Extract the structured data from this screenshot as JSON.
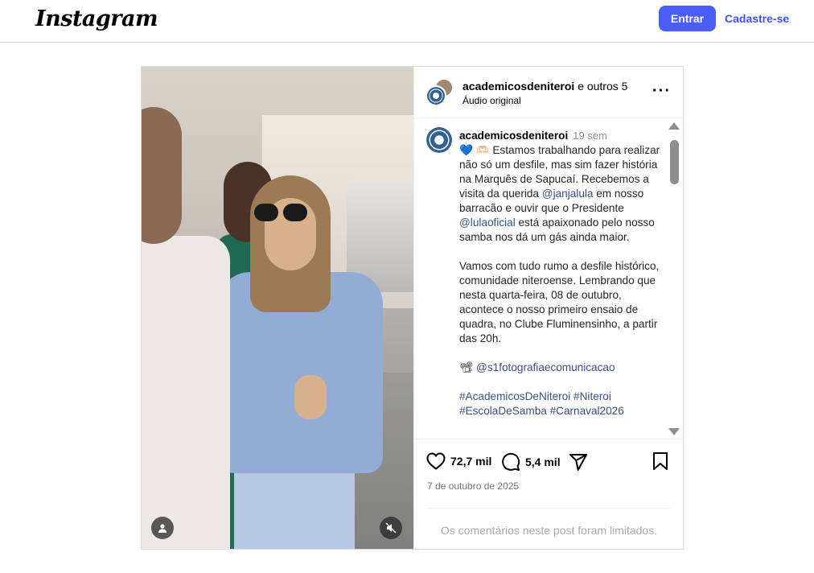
{
  "header": {
    "logo": "Instagram",
    "login_label": "Entrar",
    "signup_label": "Cadastre-se"
  },
  "post": {
    "author_line_user": "academicosdeniteroi",
    "author_line_rest": " e outros 5",
    "audio": "Áudio original",
    "caption": {
      "user": "academicosdeniteroi",
      "time": "19 sem",
      "emoji": "💙 🫶🏻",
      "p1": " Estamos trabalhando para realizar não só um desfile, mas sim fazer história na Marquês de Sapucaí. Recebemos a visita da querida ",
      "mention1": "@janjalula",
      "p2": " em nosso barracão e ouvir que o Presidente ",
      "mention2": "@lulaoficial",
      "p3": " está apaixonado pelo nosso samba nos dá um gás ainda maior.",
      "p4": "Vamos com tudo rumo a desfile histórico, comunidade niteroense. Lembrando que nesta quarta-feira, 08 de outubro, acontece o nosso primeiro ensaio de quadra, no Clube Fluminensinho, a partir das 20h.",
      "camera_emoji": "📽",
      "mention3": "@s1fotografiaecomunicacao",
      "hashtag1": "#AcademicosDeNiteroi",
      "hashtag2": "#Niteroi",
      "hashtag3": "#EscolaDeSamba",
      "hashtag4": "#Carnaval2026"
    },
    "likes": "72,7 mil",
    "comments": "5,4 mil",
    "date": "7 de outubro de 2025",
    "comments_limited": "Os comentários neste post foram limitados."
  },
  "icons": {
    "more": "more-options-icon",
    "like": "heart-icon",
    "comment": "comment-icon",
    "share": "share-icon",
    "save": "bookmark-icon",
    "user_tag": "user-icon",
    "mute": "speaker-muted-icon"
  },
  "colors": {
    "accent": "#4a5df9",
    "link": "#385185"
  }
}
